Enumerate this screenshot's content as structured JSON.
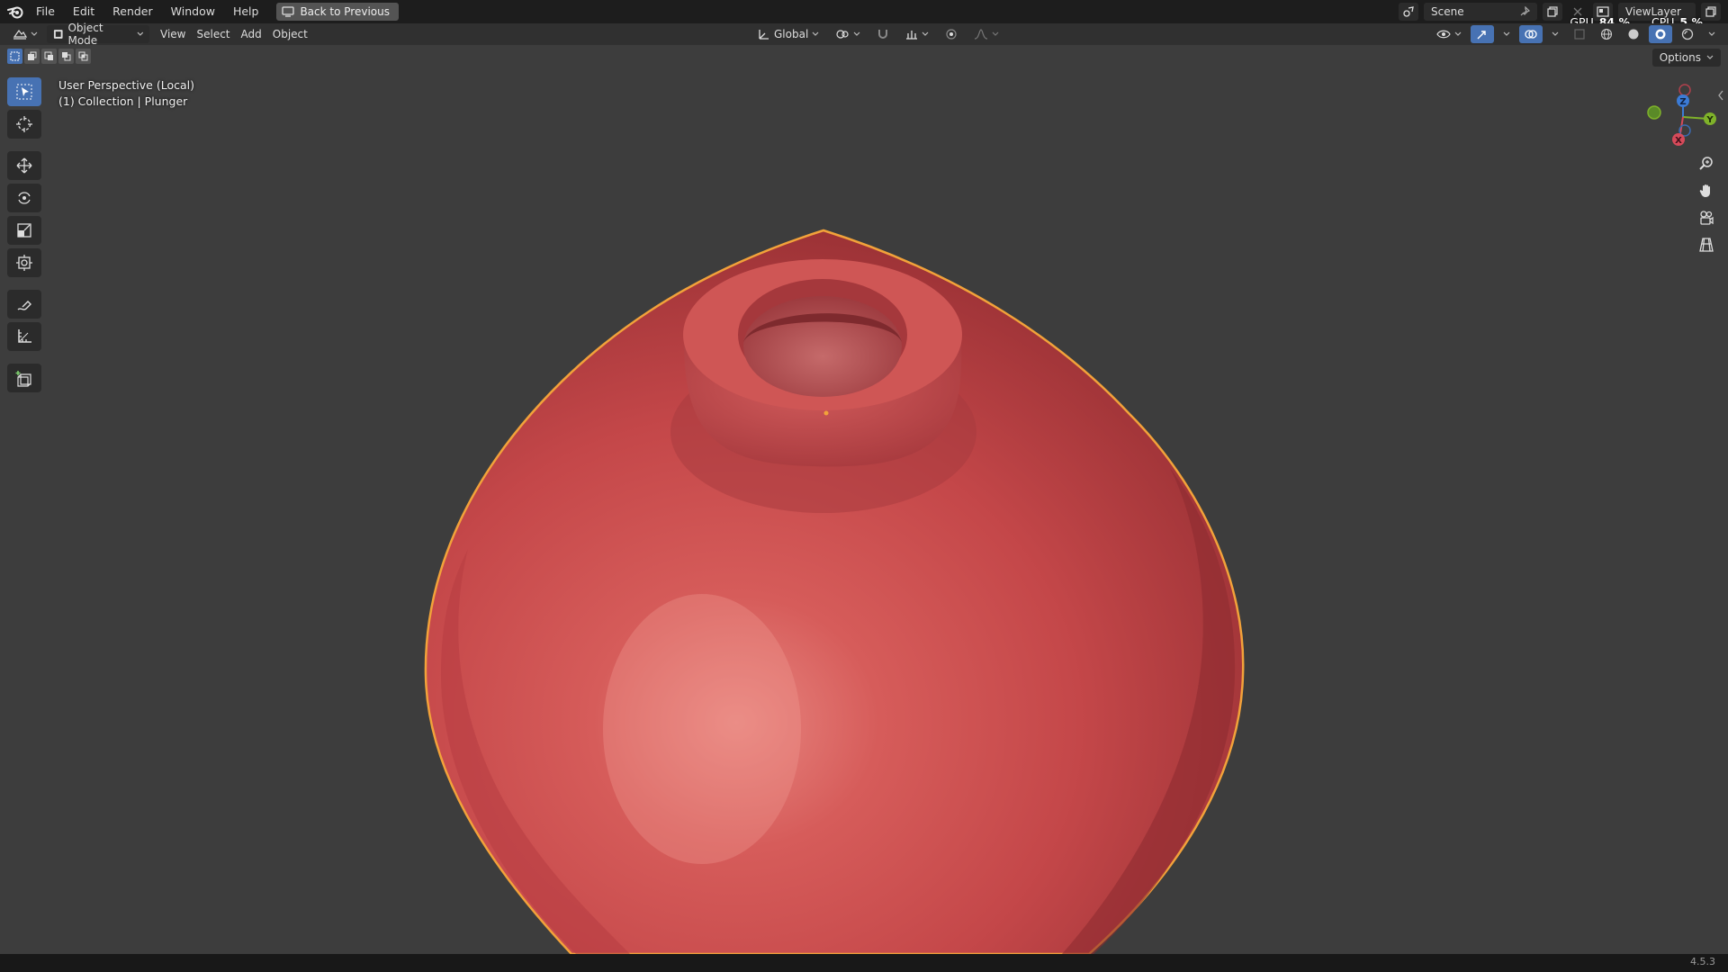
{
  "menu": {
    "items": [
      "File",
      "Edit",
      "Render",
      "Window",
      "Help"
    ],
    "back_label": "Back to Previous"
  },
  "scene": {
    "name": "Scene"
  },
  "view_layer": {
    "name": "ViewLayer"
  },
  "perf": {
    "gpu_label": "GPU",
    "gpu_value": "84 %",
    "cpu_label": "CPU",
    "cpu_value": "5 %"
  },
  "header": {
    "mode": "Object Mode",
    "menus": [
      "View",
      "Select",
      "Add",
      "Object"
    ],
    "orientation": "Global"
  },
  "viewport": {
    "perspective": "User Perspective (Local)",
    "collection": "(1) Collection | Plunger",
    "options_label": "Options"
  },
  "gizmo": {
    "x": "X",
    "y": "Y",
    "z": "Z"
  },
  "status": {
    "version": "4.5.3"
  },
  "colors": {
    "accent": "#4772b3",
    "object_red": "#c84a4c",
    "selection_outline": "#f2a23a"
  }
}
